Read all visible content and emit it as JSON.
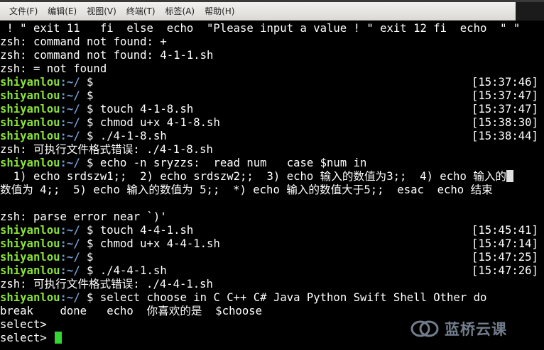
{
  "menu": {
    "items": [
      "文件(F)",
      "编辑(E)",
      "视图(V)",
      "终端(T)",
      "标签(A)",
      "帮助(H)"
    ]
  },
  "prompt": {
    "user": "shiyanlou",
    "path": ":~/",
    "symbol": " $ "
  },
  "terminal": {
    "lines": [
      {
        "text": " ! \" exit 11   fi  else  echo  \"Please input a value ! \" exit 12 fi  echo  \" \""
      },
      {
        "text": "zsh: command not found: +"
      },
      {
        "text": "zsh: command not found: 4-1-1.sh"
      },
      {
        "text": "zsh: = not found"
      },
      {
        "prompt": true,
        "cmd": "",
        "time": "[15:37:46]"
      },
      {
        "prompt": true,
        "cmd": "",
        "time": "[15:37:47]"
      },
      {
        "prompt": true,
        "cmd": "touch 4-1-8.sh",
        "time": "[15:37:47]"
      },
      {
        "prompt": true,
        "cmd": "chmod u+x 4-1-8.sh",
        "time": "[15:38:30]"
      },
      {
        "prompt": true,
        "cmd": "./4-1-8.sh",
        "time": "[15:38:44]"
      },
      {
        "text": "zsh: 可执行文件格式错误: ./4-1-8.sh"
      },
      {
        "prompt": true,
        "cmd": "echo -n sryzzs:  read num   case $num in",
        "time": ""
      },
      {
        "text": "  1) echo srdszw1;;  2) echo srdszw2;;  3) echo 输入的数值为3;;  4) echo 输入的",
        "wrap": true
      },
      {
        "text": "数值为 4;;  5) echo 输入的数值为 5;;  *) echo 输入的数值大于5;;  esac  echo 结束"
      },
      {
        "text": ""
      },
      {
        "text": "zsh: parse error near `)'"
      },
      {
        "prompt": true,
        "cmd": "touch 4-4-1.sh",
        "time": "[15:45:41]"
      },
      {
        "prompt": true,
        "cmd": "chmod u+x 4-4-1.sh",
        "time": "[15:47:14]"
      },
      {
        "prompt": true,
        "cmd": "",
        "time": "[15:47:25]"
      },
      {
        "prompt": true,
        "cmd": "./4-4-1.sh",
        "time": "[15:47:26]"
      },
      {
        "text": "zsh: 可执行文件格式错误: ./4-4-1.sh"
      },
      {
        "prompt": true,
        "cmd": "select choose in C C++ C# Java Python Swift Shell Other do",
        "time": ""
      },
      {
        "text": "break    done   echo  你喜欢的是  $choose"
      },
      {
        "text": "select>"
      },
      {
        "text": "select> ",
        "cursor": true
      }
    ]
  },
  "watermark": {
    "text": "蓝桥云课",
    "icon": "lanqiao-logo-icon"
  },
  "colors": {
    "user": "#8ae234",
    "path": "#729fcf",
    "cursor": "#33d633",
    "background": "#000000"
  }
}
